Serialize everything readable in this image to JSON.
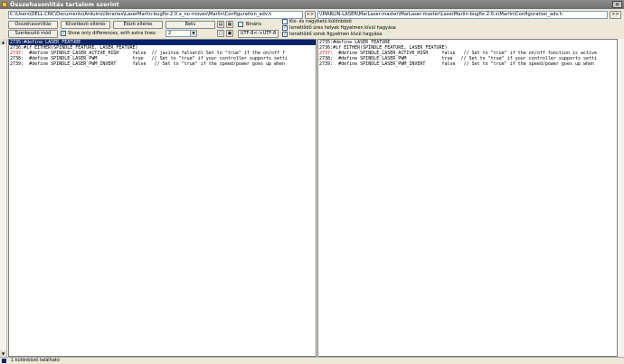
{
  "window": {
    "title": "Összehasonlítás tartalom szerint",
    "close_glyph": "×"
  },
  "left_path": "C:\\Users\\DELL-CNC\\Documents\\Arduino\\libraries\\LaserMarlin-bugfix-2.0.x_no-moves\\Marlin\\Configuration_adv.h",
  "right_path": "\\\\MARLIN-LASER\\MarLaser-master\\MarLaser-master\\LaserMarlin-bugfix-2.0.x\\Marlin\\Configuration_adv.h",
  "nav_left_label": ">>",
  "nav_right_label": ">>",
  "toolbar": {
    "compare": "Összehasonlítás",
    "next_diff": "Következő eltérés",
    "prev_diff": "Előző eltérés",
    "font": "Betű",
    "binary": "Bináris",
    "edit_mode": "Szerkesztő mód",
    "show_only_diff": "Show only differences, with extra lines:",
    "extra_lines_value": "2",
    "encoding": "UTF-8<->UTF-8",
    "case_insensitive": "Kis- és nagybetű különböző",
    "ignore_empty": "Ismétlődő üres helyek figyelmen kívül hagyása",
    "ignore_repeated": "Ismétlődő sorok figyelmen kívül hagyása"
  },
  "left_lines": [
    {
      "num": "2735:",
      "text": "#define LASER_FEATURE",
      "selected": true,
      "diff": false
    },
    {
      "num": "2736:",
      "text": "#if EITHER(SPINDLE_FEATURE, LASER_FEATURE)",
      "selected": false,
      "diff": false
    },
    {
      "num": "2737:",
      "text": "  #define SPINDLE_LASER_ACTIVE_HIGH     false  // javitva falseról Set to \"true\" if the on/off f",
      "selected": false,
      "diff": true
    },
    {
      "num": "2738:",
      "text": "  #define SPINDLE_LASER_PWM             true   // Set to \"true\" if your controller supports setti",
      "selected": false,
      "diff": false
    },
    {
      "num": "2739:",
      "text": "  #define SPINDLE_LASER_PWM_INVERT      false   // Set to \"true\" if the speed/power goes up when",
      "selected": false,
      "diff": false
    }
  ],
  "right_lines": [
    {
      "num": "2735:",
      "text": "#define LASER_FEATURE",
      "diff": false
    },
    {
      "num": "2736:",
      "text": "#if EITHER(SPINDLE_FEATURE, LASER_FEATURE)",
      "diff": false
    },
    {
      "num": "2737:",
      "text": "  #define SPINDLE_LASER_ACTIVE_HIGH     false   // Set to \"true\" if the on/off function is active",
      "diff": true
    },
    {
      "num": "2738:",
      "text": "  #define SPINDLE_LASER_PWM             true   // Set to \"true\" if your controller supports setti",
      "diff": false
    },
    {
      "num": "2739:",
      "text": "  #define SPINDLE_LASER_PWM_INVERT      false   // Set to \"true\" if the speed/power goes up when",
      "diff": false
    }
  ],
  "status": "1 különböző található"
}
